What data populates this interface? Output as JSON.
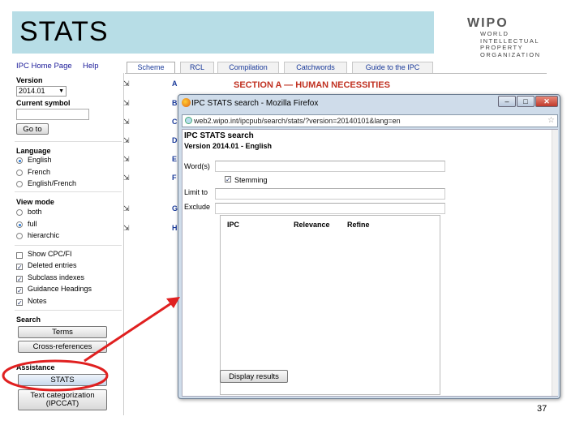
{
  "slide": {
    "title": "STATS",
    "page_number": "37"
  },
  "wipo": {
    "logo_text": "WIPO",
    "lines": [
      "WORLD",
      "INTELLECTUAL PROPERTY",
      "ORGANIZATION"
    ]
  },
  "left_panel": {
    "links": [
      "IPC Home Page",
      "Help"
    ],
    "version_label": "Version",
    "version_value": "2014.01",
    "current_symbol_label": "Current symbol",
    "goto_label": "Go to",
    "language_label": "Language",
    "language_options": [
      {
        "label": "English",
        "selected": true
      },
      {
        "label": "French",
        "selected": false
      },
      {
        "label": "English/French",
        "selected": false
      }
    ],
    "view_mode_label": "View mode",
    "view_mode_options": [
      {
        "label": "both",
        "selected": false
      },
      {
        "label": "full",
        "selected": true
      },
      {
        "label": "hierarchic",
        "selected": false
      }
    ],
    "checkboxes": [
      {
        "label": "Show CPC/FI",
        "checked": false
      },
      {
        "label": "Deleted entries",
        "checked": true
      },
      {
        "label": "Subclass indexes",
        "checked": true
      },
      {
        "label": "Guidance Headings",
        "checked": true
      },
      {
        "label": "Notes",
        "checked": true
      }
    ],
    "search_label": "Search",
    "terms_label": "Terms",
    "cross_references_label": "Cross-references",
    "assistance_label": "Assistance",
    "stats_label": "STATS",
    "ipccat_label": "Text categorization (IPCCAT)"
  },
  "tabs": [
    "Scheme",
    "RCL",
    "Compilation",
    "Catchwords",
    "Guide to the IPC"
  ],
  "section_title": "SECTION A — HUMAN NECESSITIES",
  "section_letters": [
    "A",
    "B",
    "C",
    "D",
    "E",
    "F",
    "G",
    "H"
  ],
  "popup": {
    "window_title": "IPC STATS search - Mozilla Firefox",
    "url": "web2.wipo.int/ipcpub/search/stats/?version=20140101&lang=en",
    "heading": "IPC STATS search",
    "version_line": "Version 2014.01 - English",
    "words_label": "Word(s)",
    "stemming_label": "Stemming",
    "stemming_checked": true,
    "limit_to_label": "Limit to",
    "exclude_label": "Exclude",
    "columns": [
      "IPC",
      "Relevance",
      "Refine"
    ],
    "display_results_label": "Display results"
  },
  "annotation_colors": {
    "highlight_ellipse": "#e02020",
    "arrow": "#e02020"
  }
}
